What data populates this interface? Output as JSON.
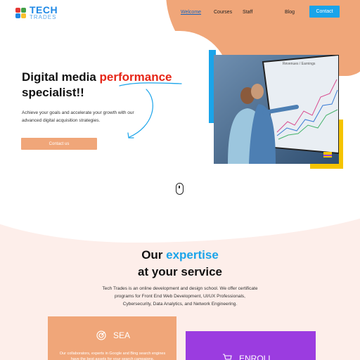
{
  "header": {
    "logo_main": "TECH",
    "logo_sub": "TRADES",
    "nav": [
      "Welcome",
      "Courses",
      "Staff",
      "Blog"
    ],
    "active_nav": "Welcome",
    "contact_label": "Contact"
  },
  "hero": {
    "title_part1": "Digital media ",
    "title_accent": "performance",
    "title_part2": "specialist!!",
    "subtitle": "Achieve your goals and accelerate your growth with our advanced digital acquisition strategies.",
    "cta_label": "Contact us",
    "image_screen_text": "Revenues / Earnings"
  },
  "expertise": {
    "title_part1": "Our ",
    "title_accent": "expertise",
    "title_part2": "at your service",
    "description": "Tech Trades is an online development and design school. We offer certificate programs for Front End Web Development, UI/UX Professionals, Cybersecurity, Data Analytics, and Network Engineering.",
    "cards": [
      {
        "title": "SEA",
        "icon": "target-icon",
        "description": "Our collaborators, experts in Google and Bing search engines have the best assets for your search campaigns."
      },
      {
        "title": "ENROLL",
        "icon": "cart-icon"
      }
    ]
  },
  "colors": {
    "accent_blue": "#1aa4ea",
    "accent_red": "#e62517",
    "peach": "#f0a679",
    "yellow": "#f5c400",
    "purple": "#9b3ce0"
  }
}
